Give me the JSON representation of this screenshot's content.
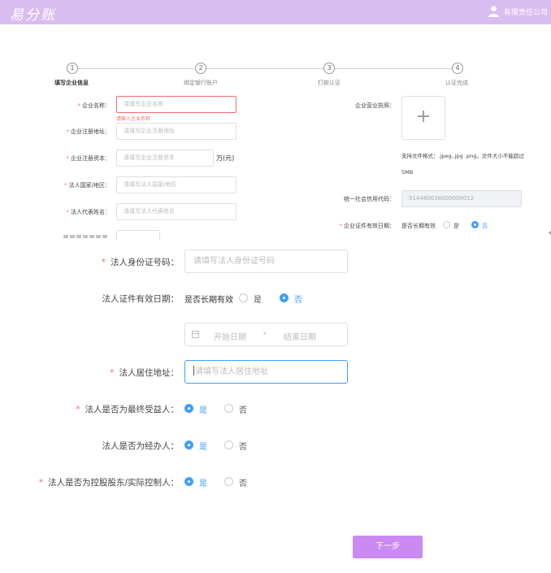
{
  "header": {
    "logo_text": "易分账",
    "company_name": "有限责任公司",
    "user_icon": "user-icon"
  },
  "steps": [
    {
      "number": "1",
      "label": "填写企业信息",
      "active": true
    },
    {
      "number": "2",
      "label": "绑定银行账户",
      "active": false
    },
    {
      "number": "3",
      "label": "打款认证",
      "active": false
    },
    {
      "number": "4",
      "label": "认证完成",
      "active": false
    }
  ],
  "form_top": {
    "company_name": {
      "label": "企业名称：",
      "placeholder": "请填写企业名称",
      "error": "请输入企业名称"
    },
    "company_address": {
      "label": "企业注册地址：",
      "placeholder": "请填写企业注册地址"
    },
    "registered_capital": {
      "label": "企业注册资本：",
      "placeholder": "请填写企业注册资本",
      "unit": "万(元)"
    },
    "legal_country": {
      "label": "法人国家/地区：",
      "placeholder": "请填写法人国家/地区"
    },
    "legal_name": {
      "label": "法人代表姓名：",
      "placeholder": "请填写法人代表姓名"
    },
    "business_license": {
      "label": "企业营业执照：",
      "upload_icon": "plus-icon",
      "hint_line1": "支持文件格式：.jpeg,.jpg .png，文件大小不能超过",
      "hint_line2": "5MB"
    },
    "credit_code": {
      "label": "统一社会信用代码：",
      "value": "914480638000000012"
    },
    "cert_validity": {
      "label": "企业证件有效日期：",
      "question": "是否长期有效",
      "yes": "是",
      "no": "否"
    }
  },
  "form_zoom": {
    "legal_id": {
      "label": "法人身份证号码：",
      "placeholder": "请填写法人身份证号码"
    },
    "legal_cert_validity": {
      "label": "法人证件有效日期：",
      "question": "是否长期有效",
      "yes": "是",
      "no": "否"
    },
    "date_range": {
      "start_placeholder": "开始日期",
      "separator": "-",
      "end_placeholder": "结束日期",
      "icon": "calendar-icon"
    },
    "legal_residence": {
      "label": "法人居住地址：",
      "placeholder": "请填写法人居住地址"
    },
    "is_beneficiary": {
      "label": "法人是否为最终受益人：",
      "yes": "是",
      "no": "否"
    },
    "is_agent": {
      "label": "法人是否为经办人：",
      "yes": "是",
      "no": "否"
    },
    "is_controller": {
      "label": "法人是否为控股股东/实际控制人：",
      "yes": "是",
      "no": "否"
    }
  },
  "actions": {
    "next_label": "下一步"
  },
  "colors": {
    "header_bg": "#d9bdf0",
    "primary": "#409eff",
    "error": "#f56c6c",
    "button": "#cb8af3"
  }
}
